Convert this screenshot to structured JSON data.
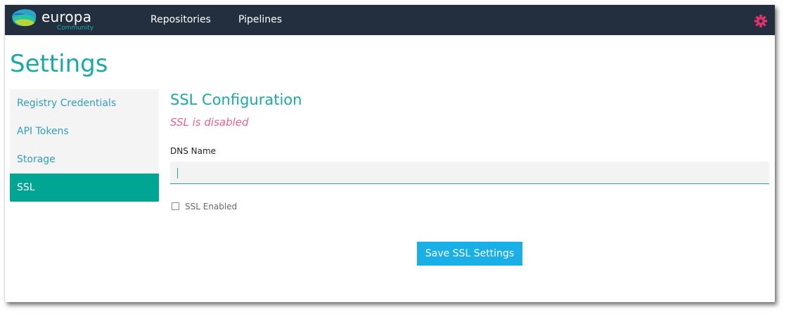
{
  "brand": {
    "name": "europa",
    "edition": "Community",
    "logo_icon": "europa-logo-icon"
  },
  "nav": {
    "links": [
      {
        "label": "Repositories"
      },
      {
        "label": "Pipelines"
      }
    ],
    "settings_icon": "gear-icon",
    "settings_icon_color": "#e8306a"
  },
  "page": {
    "title": "Settings"
  },
  "sidebar": {
    "items": [
      {
        "label": "Registry Credentials",
        "active": false
      },
      {
        "label": "API Tokens",
        "active": false
      },
      {
        "label": "Storage",
        "active": false
      },
      {
        "label": "SSL",
        "active": true
      }
    ]
  },
  "ssl": {
    "title": "SSL Configuration",
    "status": "SSL is disabled",
    "dns_label": "DNS Name",
    "dns_value": "",
    "ssl_enabled_label": "SSL Enabled",
    "ssl_enabled": false,
    "save_label": "Save SSL Settings"
  },
  "colors": {
    "navbar_bg": "#232f3f",
    "accent_teal": "#1aa9a5",
    "active_bg": "#00a594",
    "link_blue": "#2f9fbf",
    "status_pink": "#e8628a",
    "button_blue": "#1ab0e6"
  }
}
